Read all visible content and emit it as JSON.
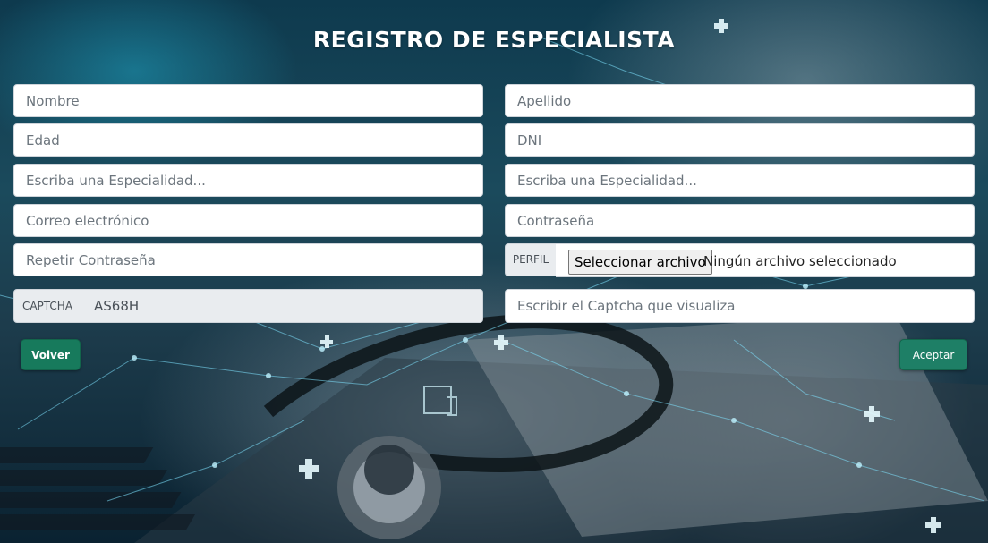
{
  "page": {
    "title": "REGISTRO DE ESPECIALISTA"
  },
  "form": {
    "nombre_placeholder": "Nombre",
    "apellido_placeholder": "Apellido",
    "edad_placeholder": "Edad",
    "dni_placeholder": "DNI",
    "especialidad1_placeholder": "Escriba una Especialidad...",
    "especialidad2_placeholder": "Escriba una Especialidad...",
    "correo_placeholder": "Correo electrónico",
    "contrasena_placeholder": "Contraseña",
    "repetir_placeholder": "Repetir Contraseña",
    "perfil_label": "PERFIL",
    "file_button_label": "Seleccionar archivo",
    "file_status": "Ningún archivo seleccionado",
    "captcha_label": "CAPTCHA",
    "captcha_value": "AS68H",
    "captcha_input_placeholder": "Escribir el Captcha que visualiza"
  },
  "buttons": {
    "back_label": "Volver",
    "accept_label": "Aceptar"
  },
  "colors": {
    "button_green": "#177a5c",
    "addon_gray": "#e9ecef",
    "placeholder_gray": "#6c757d"
  }
}
